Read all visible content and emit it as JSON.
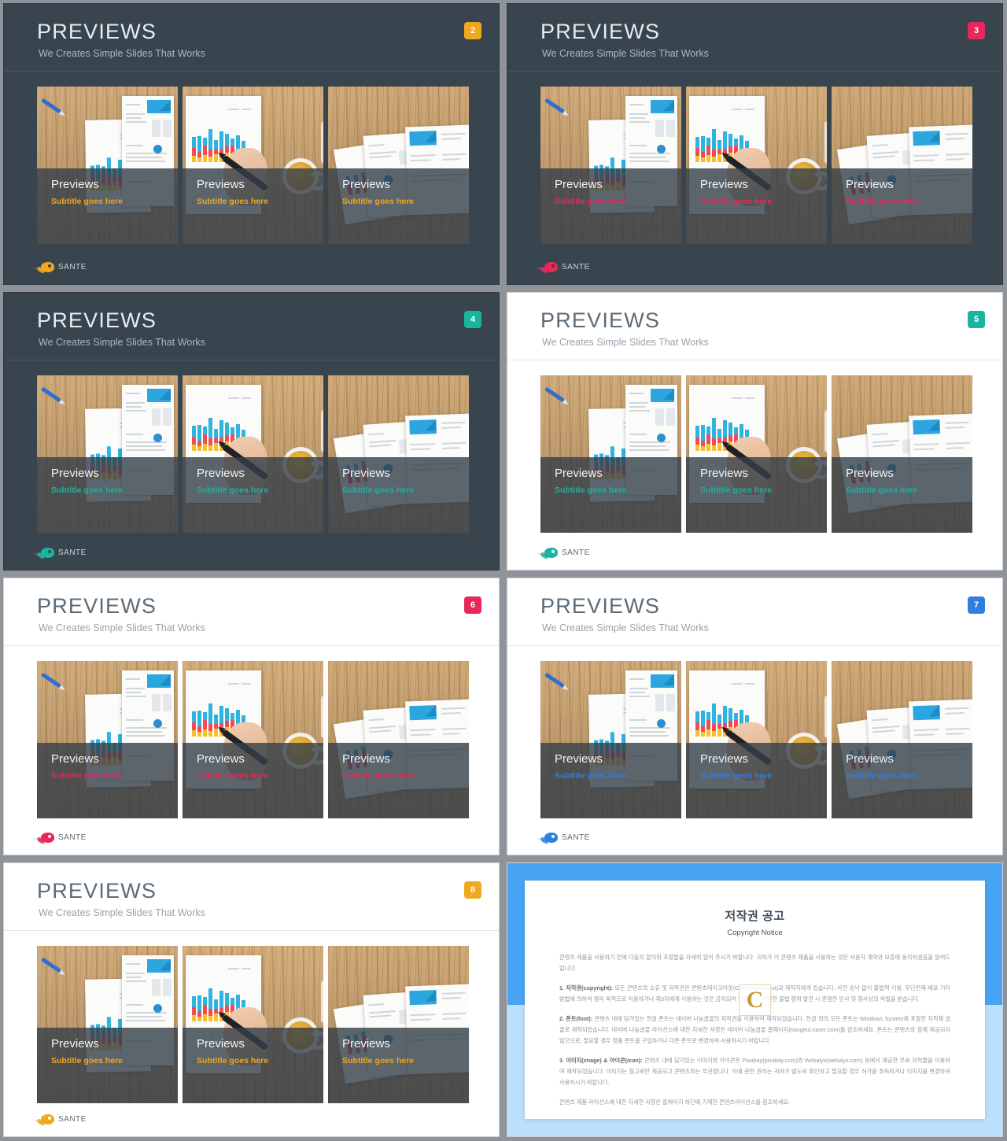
{
  "common": {
    "title": "PREVIEWS",
    "subtitle": "We Creates Simple Slides That Works",
    "brand": "SANTE",
    "card_title": "Previews",
    "card_subtitle": "Subtitle goes here",
    "photo_alts": [
      "desk-with-chart-report",
      "hand-writing-on-chart",
      "stacked-report-documents"
    ]
  },
  "slides": [
    {
      "number": "2",
      "theme": "dark",
      "accent": "#f0a81e",
      "badge_bg": "#f0a81e"
    },
    {
      "number": "3",
      "theme": "dark",
      "accent": "#e8275a",
      "badge_bg": "#e8275a"
    },
    {
      "number": "4",
      "theme": "dark",
      "accent": "#19b5a0",
      "badge_bg": "#19b5a0"
    },
    {
      "number": "5",
      "theme": "light",
      "accent": "#19b5a0",
      "badge_bg": "#19b5a0"
    },
    {
      "number": "6",
      "theme": "light",
      "accent": "#e8275a",
      "badge_bg": "#e8275a"
    },
    {
      "number": "7",
      "theme": "light",
      "accent": "#2f7fe0",
      "badge_bg": "#2f7fe0"
    },
    {
      "number": "8",
      "theme": "light",
      "accent": "#f0a81e",
      "badge_bg": "#f0a81e"
    }
  ],
  "copyright": {
    "heading_ko": "저작권 공고",
    "heading_en": "Copyright Notice",
    "watermark": "C",
    "paragraphs": [
      "콘텐츠 제품을 사용하기 전에 다음의 합의와 조항들을 자세히 읽어 주시기 바랍니다. 귀하가 이 콘텐츠 제품을 사용하는 것은 사용자 계약과 보증에 동의하셨음을 알려드립니다.",
      "1. 저작권(copyright): 모든 콘텐츠의 소유 및 저작권은 콘텐츠테이크아웃(Contentstakeout)과 제작자에게 있습니다. 사전 승낙 없이 불법적 이용, 무단전재·배포 기타 방법에 의하여 영리 목적으로 이용하거나 제3자에게 이용하는 것은 금지되어 있습니다. 이러한 불법 행위 발견 시 준엄한 민사 및 형사상의 처벌을 받습니다.",
      "2. 폰트(font): 콘텐츠 내에 담겨있는 한글 폰트는 네이버 나눔글꼴의 저작권을 이용하여 제작되었습니다. 한글 외의 모든 폰트는 Windows System에 포함한 지적재 글꼴로 제작되었습니다. 네이버 나눔글꼴 라이선스에 대한 자세한 사항은 네이버 나눔글꼴 홈페이지(hangeul.naver.com)를 참조하세요. 폰트는 콘텐츠와 함께 제공되지 않으므로, 필요할 경우 정품 폰트를 구입하거나 다른 폰트로 변경하여 사용하시기 바랍니다.",
      "3. 이미지(image) & 아이콘(icon): 콘텐츠 내에 담겨있는 이미지와 아이콘은 Pixabay(pixabay.com)와 Webalys(webalys.com) 등에서 제공한 무료 저작물을 이용하여 제작되었습니다. 이미지는 참고로만 제공되고 콘텐츠와는 무관합니다. 이에 관한 권리는 귀하가 별도로 확인하고 필요할 경우 허가를 취득하거나 이미지를 변경하여 사용하시기 바랍니다.",
      "콘텐츠 제품 라이선스에 대한 자세한 사항은 홈페이지 하단에 기재한 콘텐츠라이선스를 참조하세요."
    ]
  }
}
